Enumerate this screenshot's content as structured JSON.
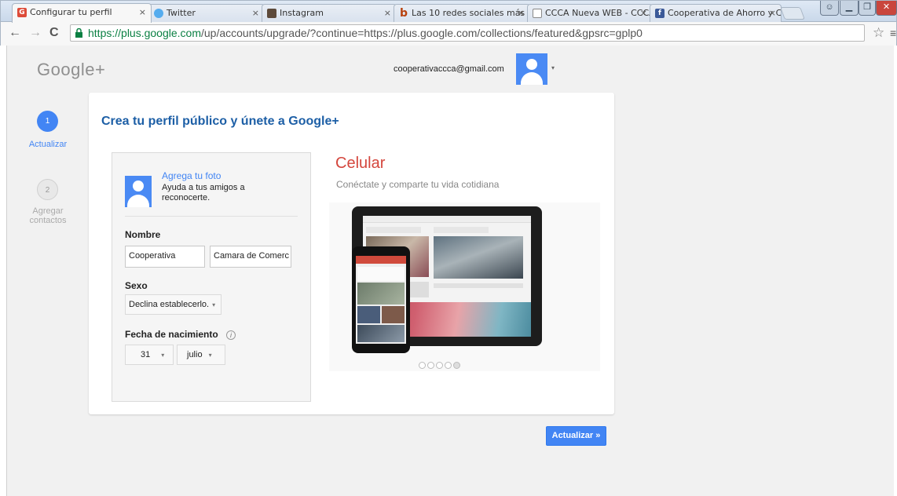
{
  "browser": {
    "tabs": [
      {
        "label": "Configurar tu perfil",
        "close": "×",
        "favicon_color": "#dd4b39",
        "favicon_glyph": "G"
      },
      {
        "label": "Twitter",
        "close": "×",
        "favicon_color": "#55acee",
        "favicon_glyph": ""
      },
      {
        "label": "Instagram",
        "close": "×",
        "favicon_color": "#5d4a3b",
        "favicon_glyph": ""
      },
      {
        "label": "Las 10 redes sociales más",
        "close": "×",
        "favicon_color": "#b7410e",
        "favicon_glyph": "b"
      },
      {
        "label": "CCCA Nueva WEB - CCCA",
        "close": "×",
        "favicon_color": "#ffffff",
        "favicon_glyph": ""
      },
      {
        "label": "Cooperativa de Ahorro y C",
        "close": "×",
        "favicon_color": "#3b5998",
        "favicon_glyph": "f"
      }
    ],
    "url_scheme": "https://",
    "url_host": "plus.google.com",
    "url_path": "/up/accounts/upgrade/?continue=https://plus.google.com/collections/featured&gpsrc=gplp0",
    "back_icon": "←",
    "forward_icon": "→",
    "reload_icon": "C",
    "star_icon": "☆",
    "menu_icon": "≡"
  },
  "header": {
    "logo": "Google+",
    "email": "cooperativaccca@gmail.com",
    "caret": "▾"
  },
  "steps": [
    {
      "number": "1",
      "label": "Actualizar"
    },
    {
      "number": "2",
      "label": "Agregar contactos"
    }
  ],
  "card": {
    "title": "Crea tu perfil público y únete a Google+",
    "photo_link": "Agrega tu foto",
    "photo_desc": "Ayuda a tus amigos a reconocerte.",
    "name_label": "Nombre",
    "first_name": "Cooperativa",
    "last_name": "Camara de Comerc",
    "gender_label": "Sexo",
    "gender_value": "Declina establecerlo.",
    "birth_label": "Fecha de nacimiento",
    "info_glyph": "i",
    "birth_day": "31",
    "birth_month": "julio",
    "select_caret": "▾"
  },
  "promo": {
    "title": "Celular",
    "subtitle": "Conéctate y comparte tu vida cotidiana",
    "slides": 5,
    "active_slide": 5
  },
  "actions": {
    "update_button": "Actualizar »"
  },
  "colors": {
    "accent": "#4285f4",
    "title_blue": "#1d5fa6",
    "promo_red": "#d4463d"
  }
}
